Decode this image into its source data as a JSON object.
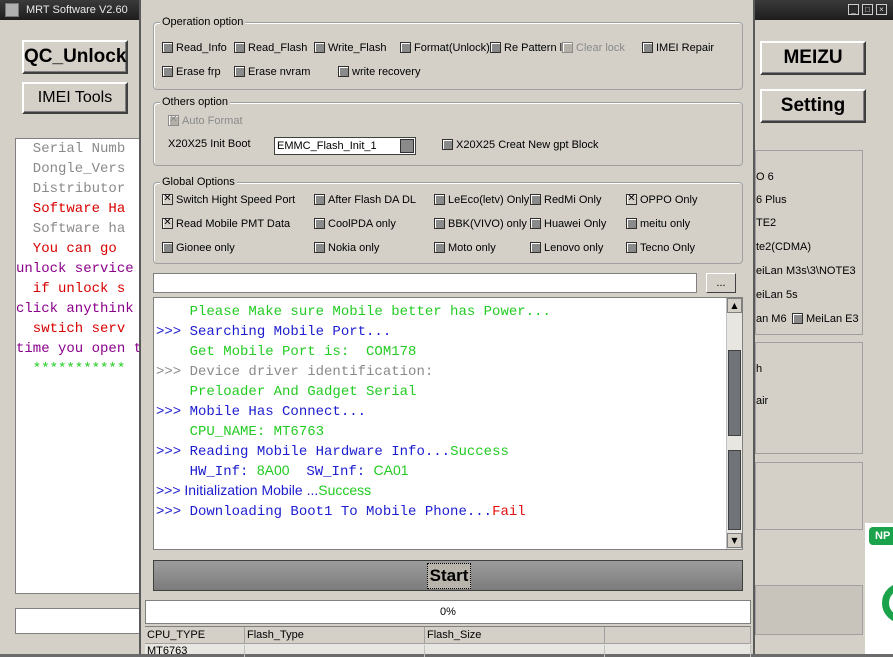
{
  "background_window": {
    "title": "MRT Software V2.60",
    "buttons": {
      "qc_unlock": "QC_Unlock",
      "imei_tools": "IMEI Tools",
      "meizu": "MEIZU",
      "setting": "Setting"
    },
    "text_lines": [
      {
        "text": "  Serial Numb",
        "color": "gray"
      },
      {
        "text": "  Dongle_Vers",
        "color": "gray"
      },
      {
        "text": "  Distributor",
        "color": "gray"
      },
      {
        "text": "  Software Ha",
        "color": "red"
      },
      {
        "text": "  Software ha",
        "color": "gray"
      },
      {
        "text": "  You can go ",
        "color": "red"
      },
      {
        "text": "unlock service",
        "color": "purple"
      },
      {
        "text": "  if unlock s",
        "color": "red"
      },
      {
        "text": "click anythink",
        "color": "purple"
      },
      {
        "text": "  swtich serv",
        "color": "red"
      },
      {
        "text": "time you open t",
        "color": "purple"
      },
      {
        "text": "  ***********",
        "color": "green"
      }
    ],
    "right_panel_items": [
      {
        "label": "O 6",
        "checkbox": false
      },
      {
        "label": "6 Plus",
        "checkbox": false
      },
      {
        "label": "TE2",
        "checkbox": false
      },
      {
        "label": "te2(CDMA)",
        "checkbox": false
      },
      {
        "label": "eiLan M3s\\3\\NOTE3",
        "checkbox": false
      },
      {
        "label": "eiLan 5s",
        "checkbox": false
      },
      {
        "label": "an M6",
        "checkbox": false
      },
      {
        "label": "MeiLan E3",
        "checkbox": true
      }
    ],
    "right_panel2_items": [
      "h",
      "air"
    ],
    "badge": "NP"
  },
  "dialog": {
    "operation_option": {
      "legend": "Operation option",
      "options": [
        {
          "label": "Read_Info",
          "checked": false,
          "enabled": true
        },
        {
          "label": "Read_Flash",
          "checked": false,
          "enabled": true
        },
        {
          "label": "Write_Flash",
          "checked": false,
          "enabled": true
        },
        {
          "label": "Format(Unlock)",
          "checked": false,
          "enabled": true
        },
        {
          "label": "Re Pattern l",
          "checked": false,
          "enabled": true
        },
        {
          "label": "Clear lock",
          "checked": false,
          "enabled": false
        },
        {
          "label": "IMEI Repair",
          "checked": false,
          "enabled": true
        },
        {
          "label": "Erase frp",
          "checked": false,
          "enabled": true
        },
        {
          "label": "Erase nvram",
          "checked": false,
          "enabled": true
        },
        {
          "label": "write recovery",
          "checked": false,
          "enabled": true
        }
      ]
    },
    "others_option": {
      "legend": "Others option",
      "auto_format": {
        "label": "Auto Format",
        "checked": true,
        "enabled": false
      },
      "init_boot_label": "X20X25 Init Boot",
      "init_boot_value": "EMMC_Flash_Init_1",
      "gpt_block": {
        "label": "X20X25 Creat New gpt Block",
        "checked": false,
        "enabled": true
      }
    },
    "global_options": {
      "legend": "Global Options",
      "options": [
        {
          "label": "Switch Hight Speed Port",
          "checked": true
        },
        {
          "label": "After Flash DA DL",
          "checked": false
        },
        {
          "label": "LeEco(letv) Only",
          "checked": false
        },
        {
          "label": "RedMi Only",
          "checked": false
        },
        {
          "label": "OPPO Only",
          "checked": true
        },
        {
          "label": "Read Mobile PMT Data",
          "checked": true
        },
        {
          "label": "CoolPDA only",
          "checked": false
        },
        {
          "label": "BBK(VIVO) only",
          "checked": false
        },
        {
          "label": "Huawei Only",
          "checked": false
        },
        {
          "label": "meitu only",
          "checked": false
        },
        {
          "label": "Gionee only",
          "checked": false
        },
        {
          "label": "Nokia only",
          "checked": false
        },
        {
          "label": "Moto only",
          "checked": false
        },
        {
          "label": "Lenovo only",
          "checked": false
        },
        {
          "label": "Tecno Only",
          "checked": false
        }
      ]
    },
    "file_path": "",
    "browse_label": "...",
    "log": [
      {
        "parts": [
          {
            "text": "    Please Make sure Mobile better has Power...",
            "color": "green",
            "font": "mono"
          }
        ]
      },
      {
        "parts": [
          {
            "text": ">>> Searching Mobile Port...",
            "color": "blue",
            "font": "mono"
          }
        ]
      },
      {
        "parts": [
          {
            "text": "    Get Mobile Port is:  COM178",
            "color": "green",
            "font": "mono"
          }
        ]
      },
      {
        "parts": [
          {
            "text": ">>> Device driver identification:",
            "color": "gray",
            "font": "mono"
          }
        ]
      },
      {
        "parts": [
          {
            "text": "    Preloader And Gadget Serial",
            "color": "green",
            "font": "mono"
          }
        ]
      },
      {
        "parts": [
          {
            "text": ">>> Mobile Has Connect...",
            "color": "blue",
            "font": "mono"
          }
        ]
      },
      {
        "parts": [
          {
            "text": "    CPU_NAME: MT6763",
            "color": "green",
            "font": "mono"
          }
        ]
      },
      {
        "parts": [
          {
            "text": ">>> Reading Mobile Hardware Info...",
            "color": "blue",
            "font": "mono"
          },
          {
            "text": "Success",
            "color": "green",
            "font": "mono"
          }
        ]
      },
      {
        "parts": [
          {
            "text": "    HW_Inf: ",
            "color": "blue",
            "font": "mono"
          },
          {
            "text": "8A00",
            "color": "green",
            "font": "sans"
          },
          {
            "text": "  SW_Inf: ",
            "color": "blue",
            "font": "mono"
          },
          {
            "text": "CA01",
            "color": "green",
            "font": "sans"
          }
        ]
      },
      {
        "parts": [
          {
            "text": ">>> Initialization Mobile ...",
            "color": "blue",
            "font": "sans"
          },
          {
            "text": "Success",
            "color": "green",
            "font": "sans"
          }
        ]
      },
      {
        "parts": [
          {
            "text": ">>> Downloading Boot1 To Mobile Phone...",
            "color": "blue",
            "font": "mono"
          },
          {
            "text": "Fail",
            "color": "red",
            "font": "mono"
          }
        ]
      }
    ],
    "log_scrollbar": {
      "up_icon": "▲",
      "down_icon": "▼"
    },
    "start_label": "Start",
    "progress": {
      "value": 0,
      "text": "0%"
    },
    "info_table": {
      "columns": [
        "CPU_TYPE",
        "Flash_Type",
        "Flash_Size",
        ""
      ],
      "row": [
        "MT6763",
        "",
        "",
        ""
      ]
    }
  }
}
